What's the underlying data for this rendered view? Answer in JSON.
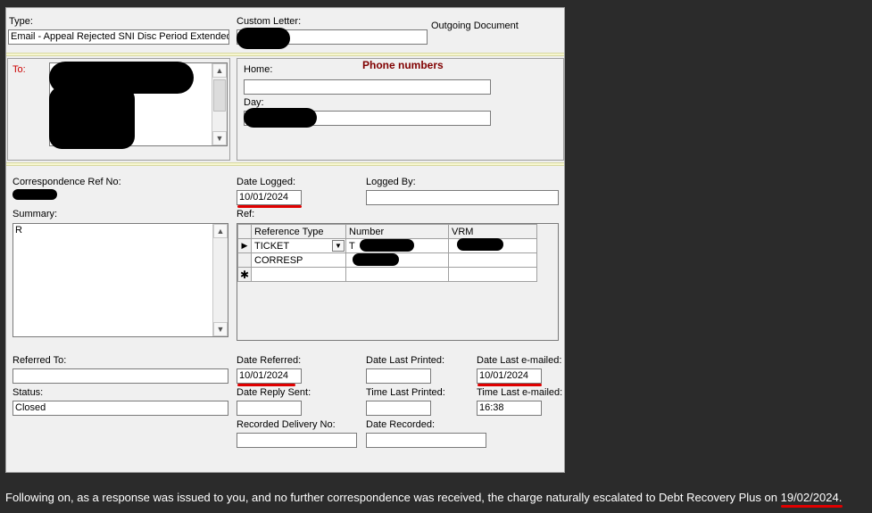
{
  "header": {
    "type_label": "Type:",
    "type_value": "Email - Appeal Rejected SNI Disc Period Extended",
    "custom_letter_label": "Custom Letter:",
    "custom_letter_value": "",
    "outgoing_label": "Outgoing Document"
  },
  "recipient": {
    "to_label": "To:",
    "phone_title": "Phone numbers",
    "home_label": "Home:",
    "home_value": "",
    "day_label": "Day:",
    "day_value": ""
  },
  "details": {
    "corr_ref_label": "Correspondence Ref No:",
    "date_logged_label": "Date Logged:",
    "date_logged_value": "10/01/2024",
    "logged_by_label": "Logged By:",
    "logged_by_value": "",
    "summary_label": "Summary:",
    "summary_value": "R",
    "ref_label": "Ref:"
  },
  "ref_table": {
    "headers": [
      "Reference Type",
      "Number",
      "VRM"
    ],
    "rows": [
      {
        "type": "TICKET",
        "number": "T",
        "vrm": ""
      },
      {
        "type": "CORRESP",
        "number": "",
        "vrm": ""
      }
    ]
  },
  "referral": {
    "referred_to_label": "Referred To:",
    "referred_to_value": "",
    "status_label": "Status:",
    "status_value": "Closed",
    "date_referred_label": "Date Referred:",
    "date_referred_value": "10/01/2024",
    "date_reply_label": "Date Reply Sent:",
    "date_reply_value": "",
    "recorded_delivery_label": "Recorded Delivery No:",
    "recorded_delivery_value": "",
    "date_last_printed_label": "Date Last Printed:",
    "date_last_printed_value": "",
    "time_last_printed_label": "Time Last Printed:",
    "time_last_printed_value": "",
    "date_recorded_label": "Date Recorded:",
    "date_recorded_value": "",
    "date_last_emailed_label": "Date Last e-mailed:",
    "date_last_emailed_value": "10/01/2024",
    "time_last_emailed_label": "Time Last e-mailed:",
    "time_last_emailed_value": "16:38"
  },
  "caption": {
    "text": "Following on, as a response was issued to you, and no further correspondence was received, the charge naturally escalated to Debt Recovery Plus on ",
    "date": "19/02/2024",
    "end": "."
  },
  "colors": {
    "red_label": "#cc0000",
    "phone_title": "#800000",
    "annotation_red": "#e00000",
    "background": "#2b2b2b"
  }
}
